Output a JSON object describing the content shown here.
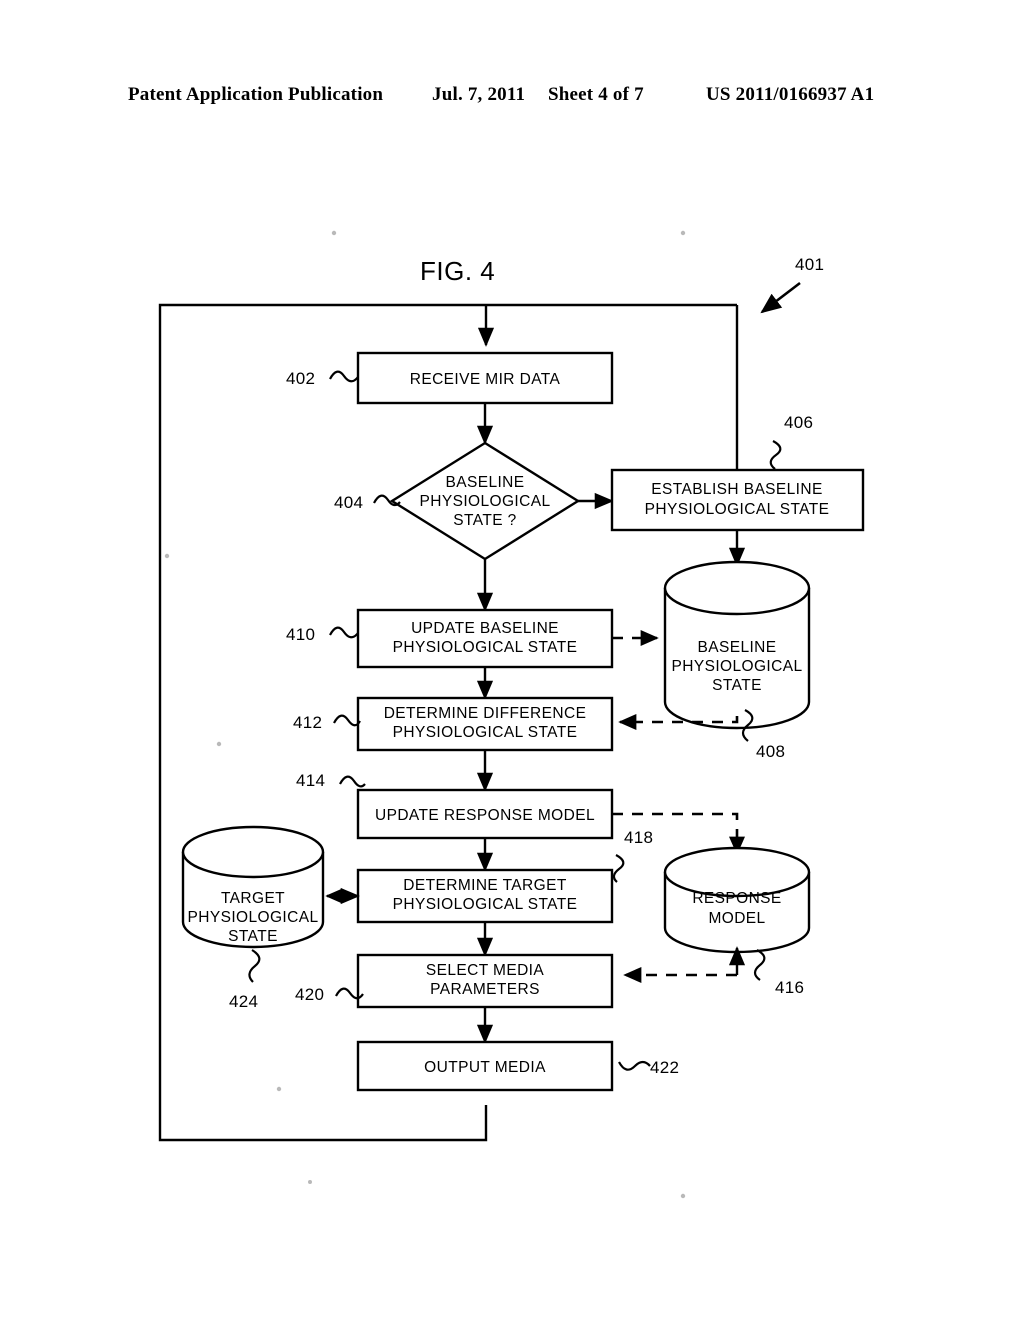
{
  "header": {
    "publication": "Patent Application Publication",
    "date": "Jul. 7, 2011",
    "sheet": "Sheet 4 of 7",
    "number": "US 2011/0166937 A1"
  },
  "figure": {
    "title": "FIG. 4",
    "diagram_ref": "401"
  },
  "nodes": {
    "n402": {
      "ref": "402",
      "label_line1": "RECEIVE MIR DATA",
      "label_line2": "",
      "label_line3": "",
      "type": "process"
    },
    "n404": {
      "ref": "404",
      "label_line1": "BASELINE",
      "label_line2": "PHYSIOLOGICAL",
      "label_line3": "STATE ?",
      "type": "decision"
    },
    "n406": {
      "ref": "406",
      "label_line1": "ESTABLISH BASELINE",
      "label_line2": "PHYSIOLOGICAL STATE",
      "label_line3": "",
      "type": "process"
    },
    "n408": {
      "ref": "408",
      "label_line1": "BASELINE",
      "label_line2": "PHYSIOLOGICAL",
      "label_line3": "STATE",
      "type": "datastore"
    },
    "n410": {
      "ref": "410",
      "label_line1": "UPDATE BASELINE",
      "label_line2": "PHYSIOLOGICAL STATE",
      "label_line3": "",
      "type": "process"
    },
    "n412": {
      "ref": "412",
      "label_line1": "DETERMINE DIFFERENCE",
      "label_line2": "PHYSIOLOGICAL STATE",
      "label_line3": "",
      "type": "process"
    },
    "n414": {
      "ref": "414",
      "label_line1": "UPDATE RESPONSE MODEL",
      "label_line2": "",
      "label_line3": "",
      "type": "process"
    },
    "n416": {
      "ref": "416",
      "label_line1": "RESPONSE",
      "label_line2": "MODEL",
      "label_line3": "",
      "type": "datastore"
    },
    "n418": {
      "ref": "418",
      "label_line1": "DETERMINE TARGET",
      "label_line2": "PHYSIOLOGICAL STATE",
      "label_line3": "",
      "type": "process"
    },
    "n420": {
      "ref": "420",
      "label_line1": "SELECT MEDIA",
      "label_line2": "PARAMETERS",
      "label_line3": "",
      "type": "process"
    },
    "n422": {
      "ref": "422",
      "label_line1": "OUTPUT MEDIA",
      "label_line2": "",
      "label_line3": "",
      "type": "process"
    },
    "n424": {
      "ref": "424",
      "label_line1": "TARGET",
      "label_line2": "PHYSIOLOGICAL",
      "label_line3": "STATE",
      "type": "datastore"
    }
  },
  "colors": {
    "ink": "#000000",
    "paper": "#ffffff"
  }
}
